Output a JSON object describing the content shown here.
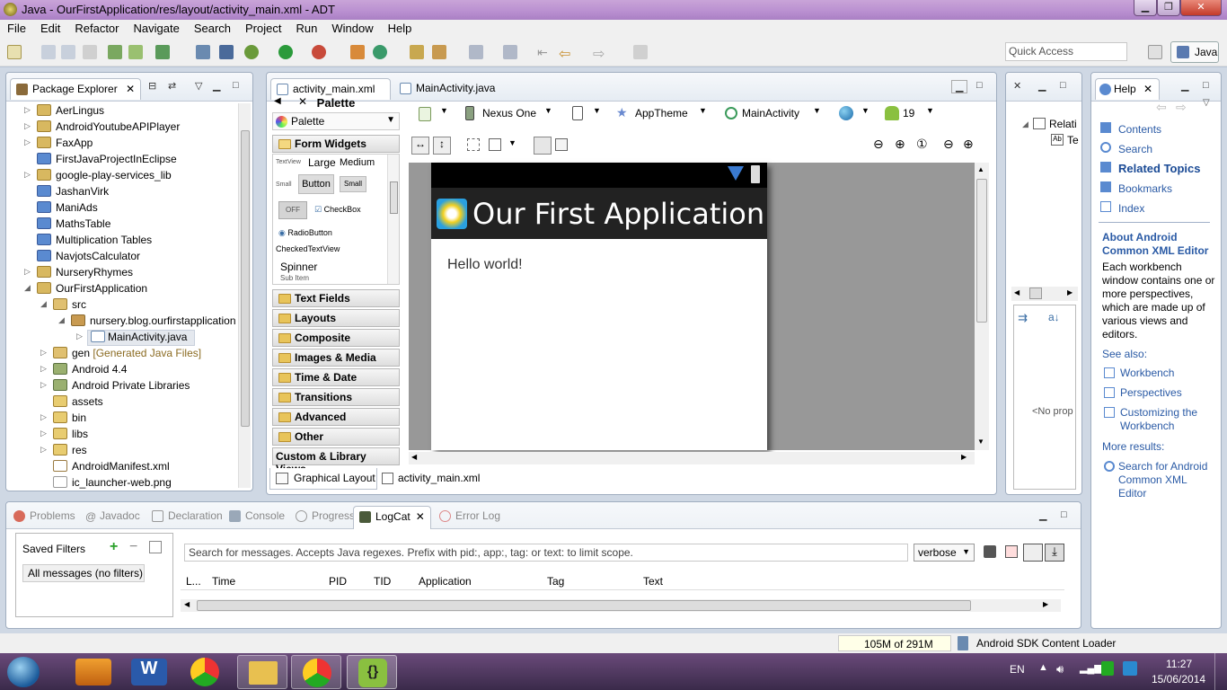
{
  "window": {
    "title": "Java - OurFirstApplication/res/layout/activity_main.xml - ADT"
  },
  "menu": [
    "File",
    "Edit",
    "Refactor",
    "Navigate",
    "Search",
    "Project",
    "Run",
    "Window",
    "Help"
  ],
  "toolbar": {
    "quick_access": "Quick Access",
    "perspective": "Java"
  },
  "package_explorer": {
    "title": "Package Explorer",
    "items": [
      {
        "label": "AerLingus"
      },
      {
        "label": "AndroidYoutubeAPIPlayer"
      },
      {
        "label": "FaxApp"
      },
      {
        "label": "FirstJavaProjectInEclipse"
      },
      {
        "label": "google-play-services_lib"
      },
      {
        "label": "JashanVirk"
      },
      {
        "label": "ManiAds"
      },
      {
        "label": "MathsTable"
      },
      {
        "label": "Multiplication Tables"
      },
      {
        "label": "NavjotsCalculator"
      },
      {
        "label": "NurseryRhymes"
      },
      {
        "label": "OurFirstApplication"
      },
      {
        "label": "src"
      },
      {
        "label": "nursery.blog.ourfirstapplication"
      },
      {
        "label": "MainActivity.java"
      },
      {
        "label": "gen",
        "extra": "[Generated Java Files]"
      },
      {
        "label": "Android 4.4"
      },
      {
        "label": "Android Private Libraries"
      },
      {
        "label": "assets"
      },
      {
        "label": "bin"
      },
      {
        "label": "libs"
      },
      {
        "label": "res"
      },
      {
        "label": "AndroidManifest.xml"
      },
      {
        "label": "ic_launcher-web.png"
      }
    ]
  },
  "editor": {
    "tabs": [
      "activity_main.xml",
      "MainActivity.java"
    ],
    "palette_title": "Palette",
    "palette_dropdown": "Palette",
    "categories": [
      "Form Widgets",
      "Text Fields",
      "Layouts",
      "Composite",
      "Images & Media",
      "Time & Date",
      "Transitions",
      "Advanced",
      "Other",
      "Custom & Library Views"
    ],
    "widgets": {
      "textview": "TextView",
      "large": "Large",
      "medium": "Medium",
      "small": "Small",
      "button": "Button",
      "small_btn": "Small",
      "off": "OFF",
      "checkbox": "CheckBox",
      "radio": "RadioButton",
      "checked_textview": "CheckedTextView",
      "spinner": "Spinner",
      "sub_item": "Sub Item"
    },
    "config": {
      "device": "Nexus One",
      "theme": "AppTheme",
      "activity": "MainActivity",
      "api": "19"
    },
    "app_title": "Our First Application",
    "hello": "Hello world!",
    "bottom_tabs": [
      "Graphical Layout",
      "activity_main.xml"
    ]
  },
  "outline": {
    "items": [
      "Relati",
      "Te"
    ],
    "no_props": "<No prop"
  },
  "help": {
    "title": "Help",
    "links": [
      "Contents",
      "Search",
      "Related Topics",
      "Bookmarks",
      "Index"
    ],
    "about_title": "About Android Common XML Editor",
    "about_text": "Each workbench window contains one or more perspectives, which are made up of various views and editors.",
    "see_also": "See also:",
    "see_links": [
      "Workbench",
      "Perspectives",
      "Customizing the Workbench"
    ],
    "more_results": "More results:",
    "search_link": "Search for Android Common XML Editor"
  },
  "bottom": {
    "tabs": [
      "Problems",
      "Javadoc",
      "Declaration",
      "Console",
      "Progress",
      "LogCat",
      "Error Log"
    ],
    "saved_filters": "Saved Filters",
    "all_messages": "All messages (no filters)",
    "search_placeholder": "Search for messages. Accepts Java regexes. Prefix with pid:, app:, tag: or text: to limit scope.",
    "level": "verbose",
    "columns": [
      "L...",
      "Time",
      "PID",
      "TID",
      "Application",
      "Tag",
      "Text"
    ]
  },
  "statusbar": {
    "memory": "105M of 291M",
    "loader": "Android SDK Content Loader"
  },
  "taskbar": {
    "lang": "EN",
    "time": "11:27",
    "date": "15/06/2014"
  },
  "colors": {
    "accent": "#3a6ea5",
    "titlebar": "#b98fd0",
    "taskbar": "#3a2a4a"
  }
}
